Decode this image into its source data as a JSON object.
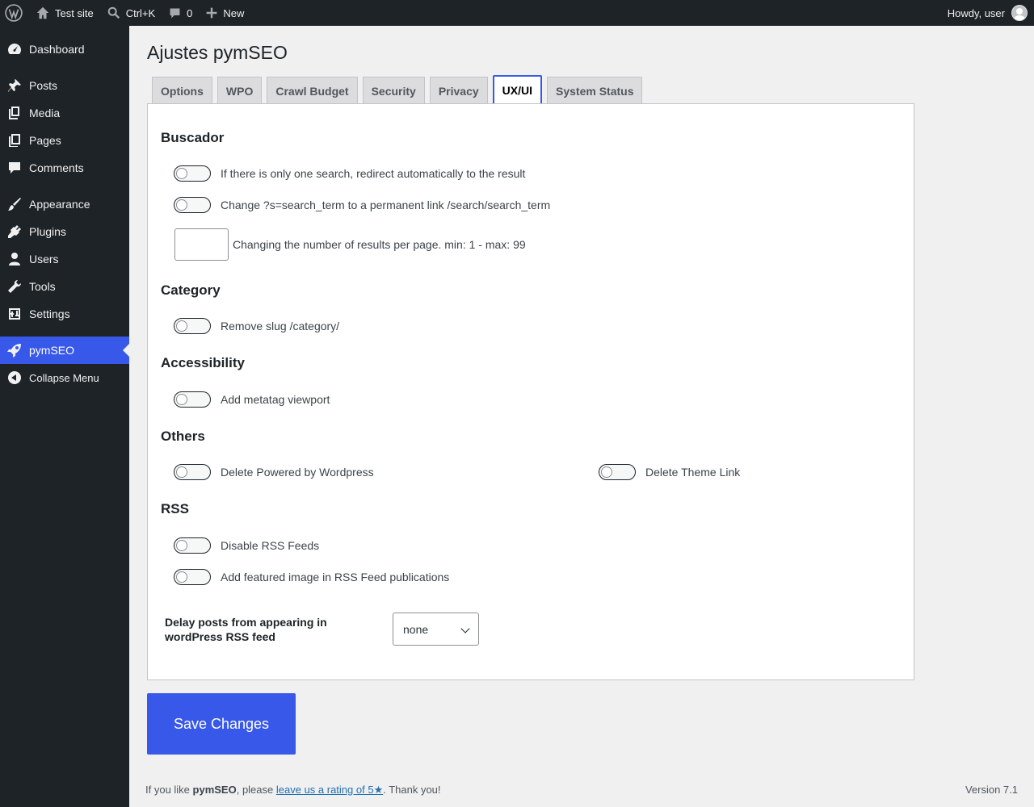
{
  "admin_bar": {
    "site_name": "Test site",
    "search_shortcut": "Ctrl+K",
    "comments_count": "0",
    "new_label": "New",
    "howdy": "Howdy, user"
  },
  "sidebar": {
    "items": [
      {
        "label": "Dashboard",
        "icon": "dashboard-icon"
      },
      {
        "label": "Posts",
        "icon": "pin-icon"
      },
      {
        "label": "Media",
        "icon": "media-icon"
      },
      {
        "label": "Pages",
        "icon": "pages-icon"
      },
      {
        "label": "Comments",
        "icon": "comment-icon"
      },
      {
        "label": "Appearance",
        "icon": "brush-icon"
      },
      {
        "label": "Plugins",
        "icon": "plug-icon"
      },
      {
        "label": "Users",
        "icon": "user-icon"
      },
      {
        "label": "Tools",
        "icon": "wrench-icon"
      },
      {
        "label": "Settings",
        "icon": "sliders-icon"
      },
      {
        "label": "pymSEO",
        "icon": "rocket-icon"
      }
    ],
    "collapse_label": "Collapse Menu",
    "accent_color": "#3858e9"
  },
  "page": {
    "title": "Ajustes pymSEO",
    "tabs": [
      "Options",
      "WPO",
      "Crawl Budget",
      "Security",
      "Privacy",
      "UX/UI",
      "System Status"
    ],
    "active_tab": "UX/UI"
  },
  "sections": {
    "buscador": {
      "heading": "Buscador",
      "redirect_single": "If there is only one search, redirect automatically to the result",
      "permalink_search": "Change ?s=search_term to a permanent link /search/search_term",
      "results_per_page": "Changing the number of results per page. min: 1 - max: 99"
    },
    "category": {
      "heading": "Category",
      "remove_slug": "Remove slug /category/"
    },
    "accessibility": {
      "heading": "Accessibility",
      "viewport": "Add metatag viewport"
    },
    "others": {
      "heading": "Others",
      "powered_by": "Delete Powered by Wordpress",
      "theme_link": "Delete Theme Link"
    },
    "rss": {
      "heading": "RSS",
      "disable_feeds": "Disable RSS Feeds",
      "featured_image": "Add featured image in RSS Feed publications",
      "delay_label": "Delay posts from appearing in wordPress RSS feed",
      "delay_value": "none"
    }
  },
  "save_label": "Save Changes",
  "footer": {
    "prefix": "If you like ",
    "brand": "pymSEO",
    "middle": ", please ",
    "link": "leave us a rating of 5★",
    "suffix": ". Thank you!",
    "version": "Version 7.1"
  }
}
